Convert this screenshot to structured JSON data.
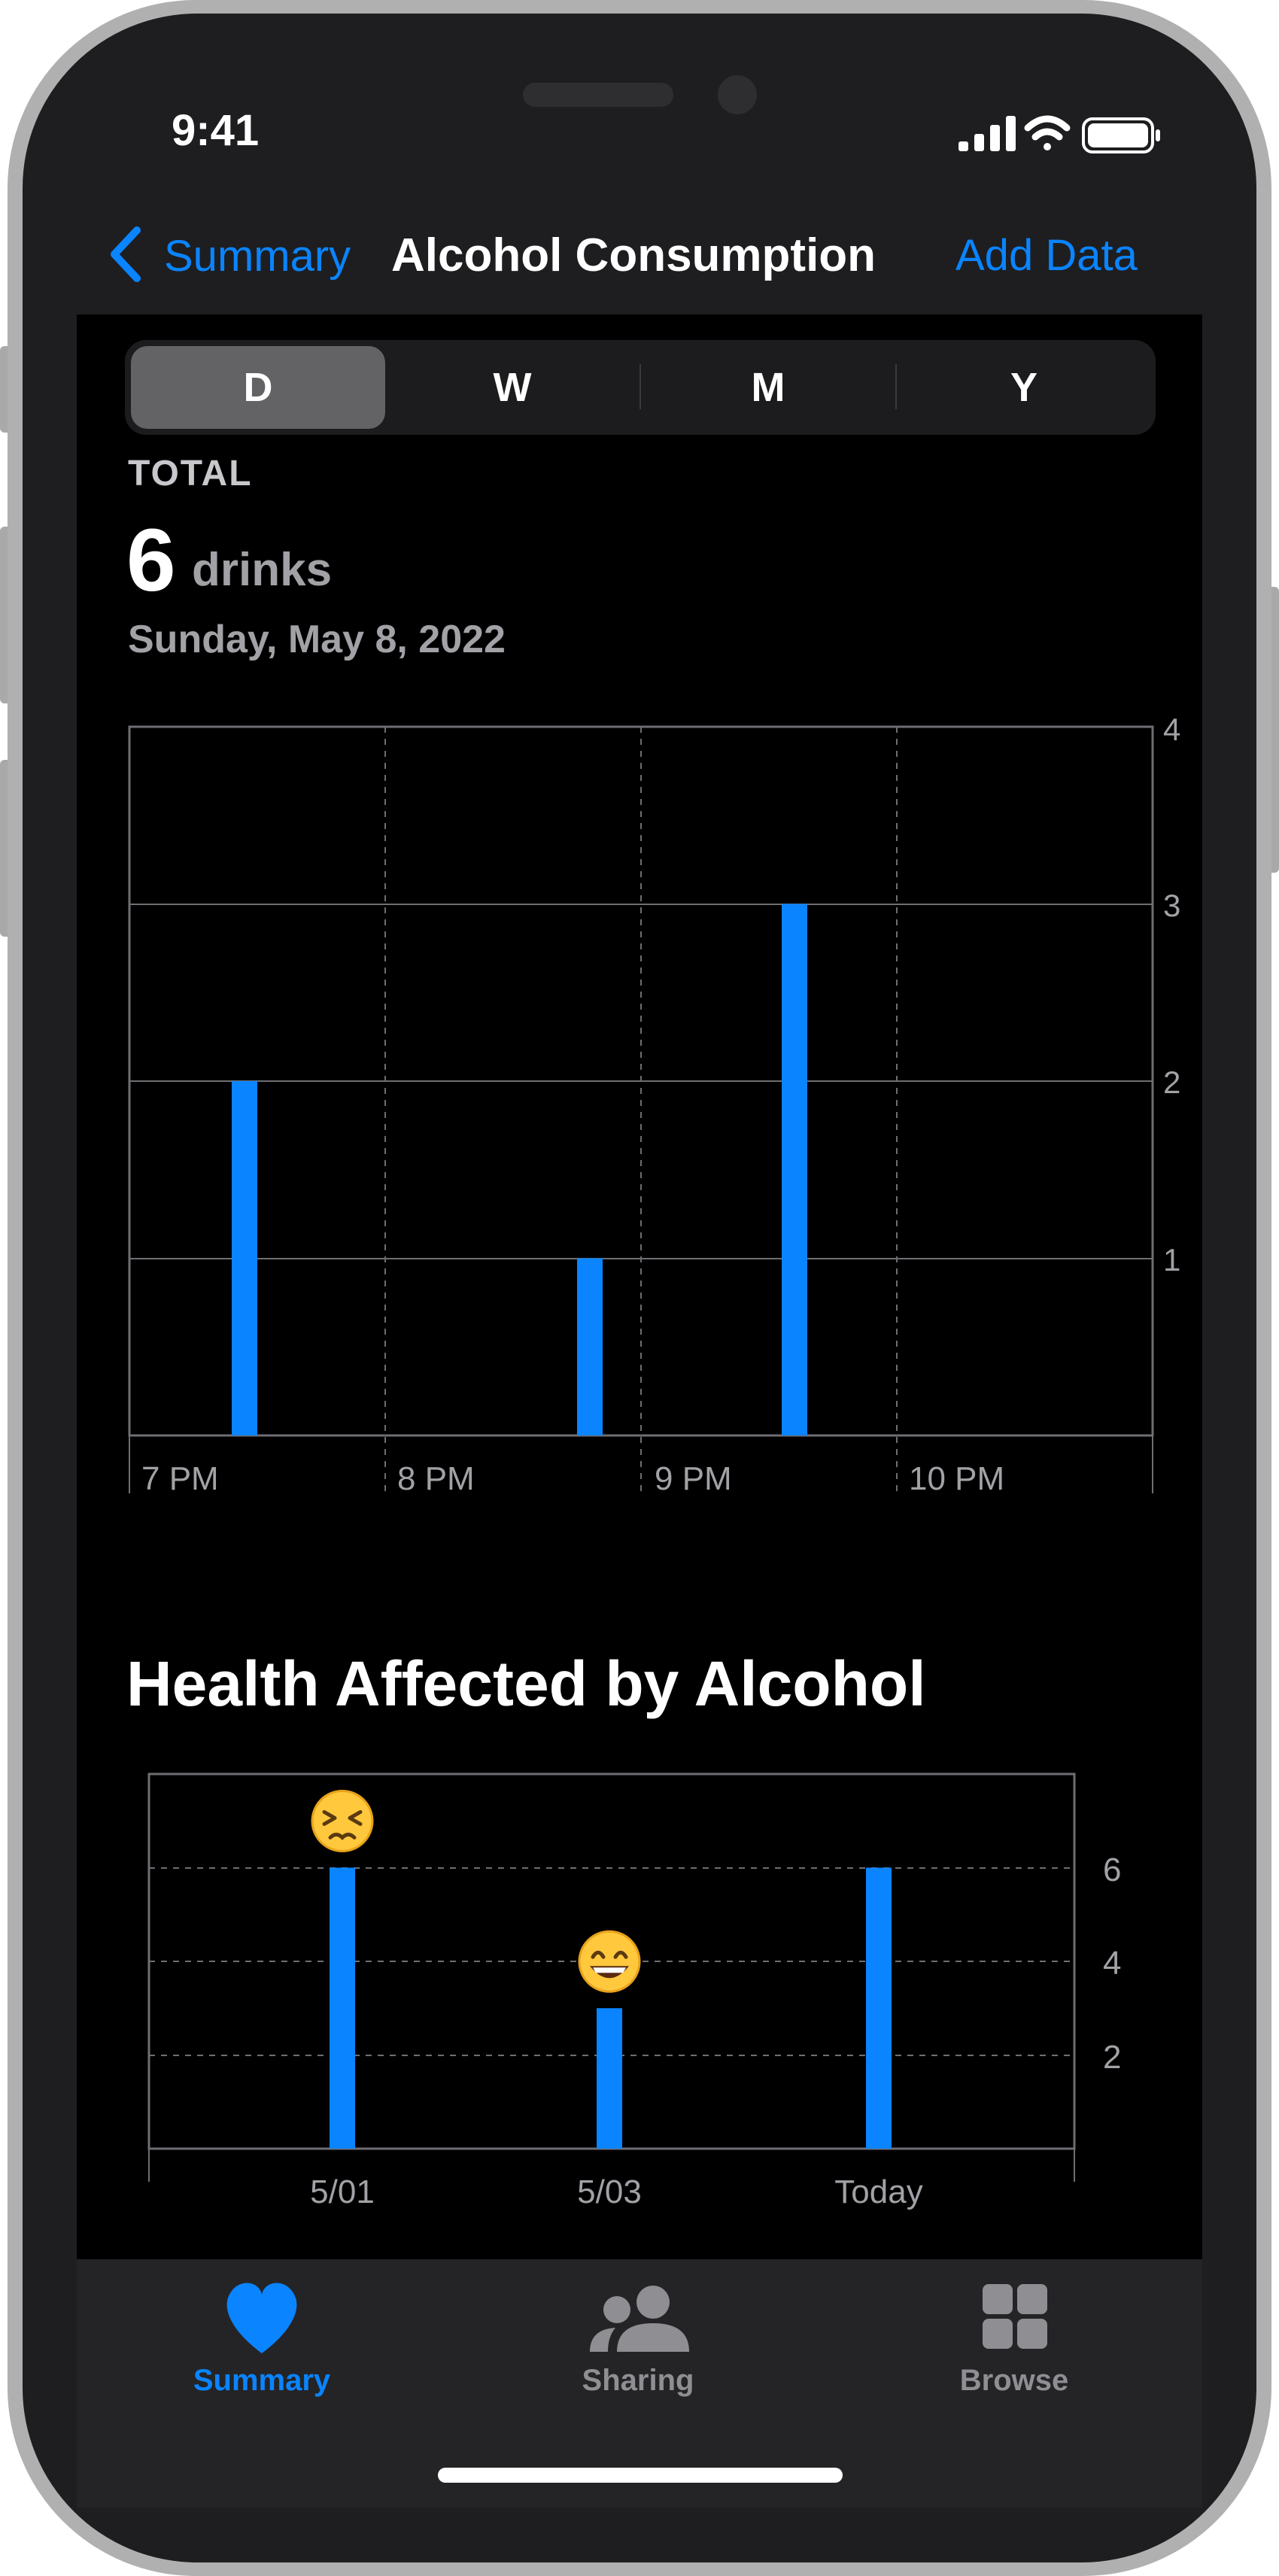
{
  "status_bar": {
    "time": "9:41"
  },
  "nav": {
    "back_label": "Summary",
    "title": "Alcohol Consumption",
    "action_label": "Add Data"
  },
  "segments": [
    {
      "label": "D",
      "selected": true
    },
    {
      "label": "W",
      "selected": false
    },
    {
      "label": "M",
      "selected": false
    },
    {
      "label": "Y",
      "selected": false
    }
  ],
  "total": {
    "label": "TOTAL",
    "value": "6",
    "unit": "drinks",
    "date": "Sunday, May 8, 2022"
  },
  "section_title": "Health Affected by Alcohol",
  "chart_data": [
    {
      "type": "bar",
      "x_ticks": [
        "7 PM",
        "8 PM",
        "9 PM",
        "10 PM"
      ],
      "x": [
        7.45,
        8.8,
        9.6
      ],
      "values": [
        2,
        1,
        3
      ],
      "ylim": [
        0,
        4
      ],
      "y_ticks": [
        1,
        2,
        3,
        4
      ],
      "grid": true,
      "color": "#0a84ff"
    },
    {
      "type": "bar",
      "categories": [
        "5/01",
        "5/03",
        "Today"
      ],
      "values": [
        6,
        3,
        6
      ],
      "annotations": [
        "persevering-face-emoji",
        "grinning-face-emoji",
        ""
      ],
      "ylim": [
        0,
        8
      ],
      "y_ticks": [
        2,
        4,
        6
      ],
      "grid": true,
      "color": "#0a84ff"
    }
  ],
  "tab_bar": [
    {
      "label": "Summary",
      "icon": "heart-icon",
      "active": true
    },
    {
      "label": "Sharing",
      "icon": "people-icon",
      "active": false
    },
    {
      "label": "Browse",
      "icon": "grid-icon",
      "active": false
    }
  ],
  "colors": {
    "accent": "#0a84ff",
    "background": "#000000",
    "frame": "#b0b0b0",
    "inactive": "#8e8e93"
  }
}
